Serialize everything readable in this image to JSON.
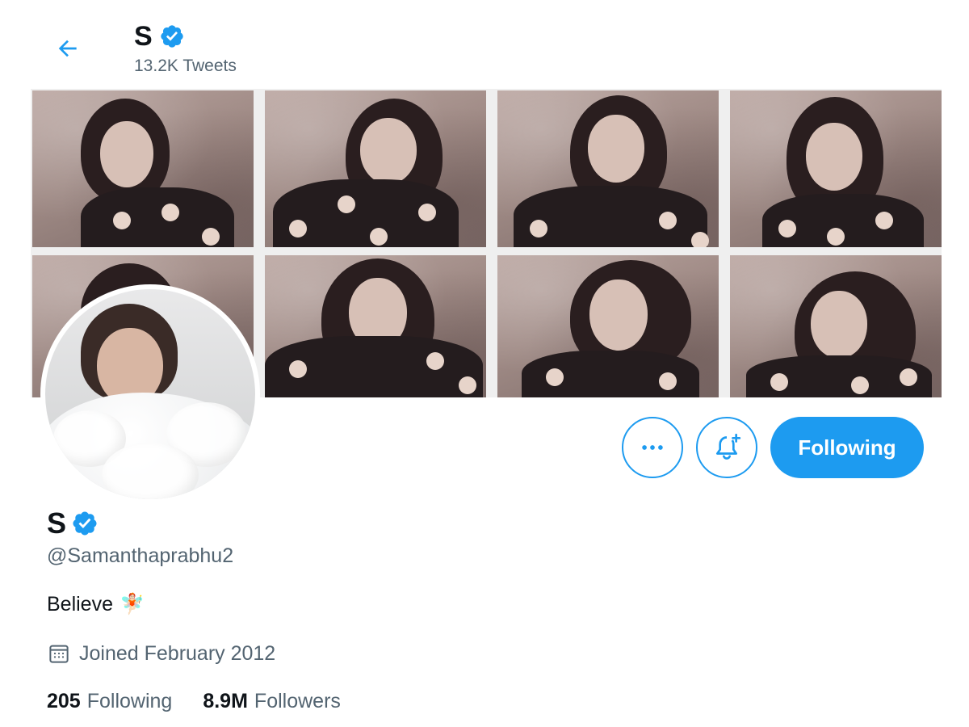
{
  "header": {
    "name": "S",
    "tweet_count": "13.2K Tweets"
  },
  "profile": {
    "display_name": "S",
    "handle": "@Samanthaprabhu2",
    "bio": "Believe",
    "bio_emoji": "🧚🏻",
    "joined": "Joined February 2012",
    "following_count": "205",
    "following_label": "Following",
    "followers_count": "8.9M",
    "followers_label": "Followers",
    "verified": true
  },
  "actions": {
    "more_icon": "more-icon",
    "notify_icon": "bell-plus-icon",
    "follow_button_label": "Following"
  },
  "colors": {
    "accent": "#1d9bf0",
    "text_primary": "#0f1419",
    "text_secondary": "#536471"
  }
}
